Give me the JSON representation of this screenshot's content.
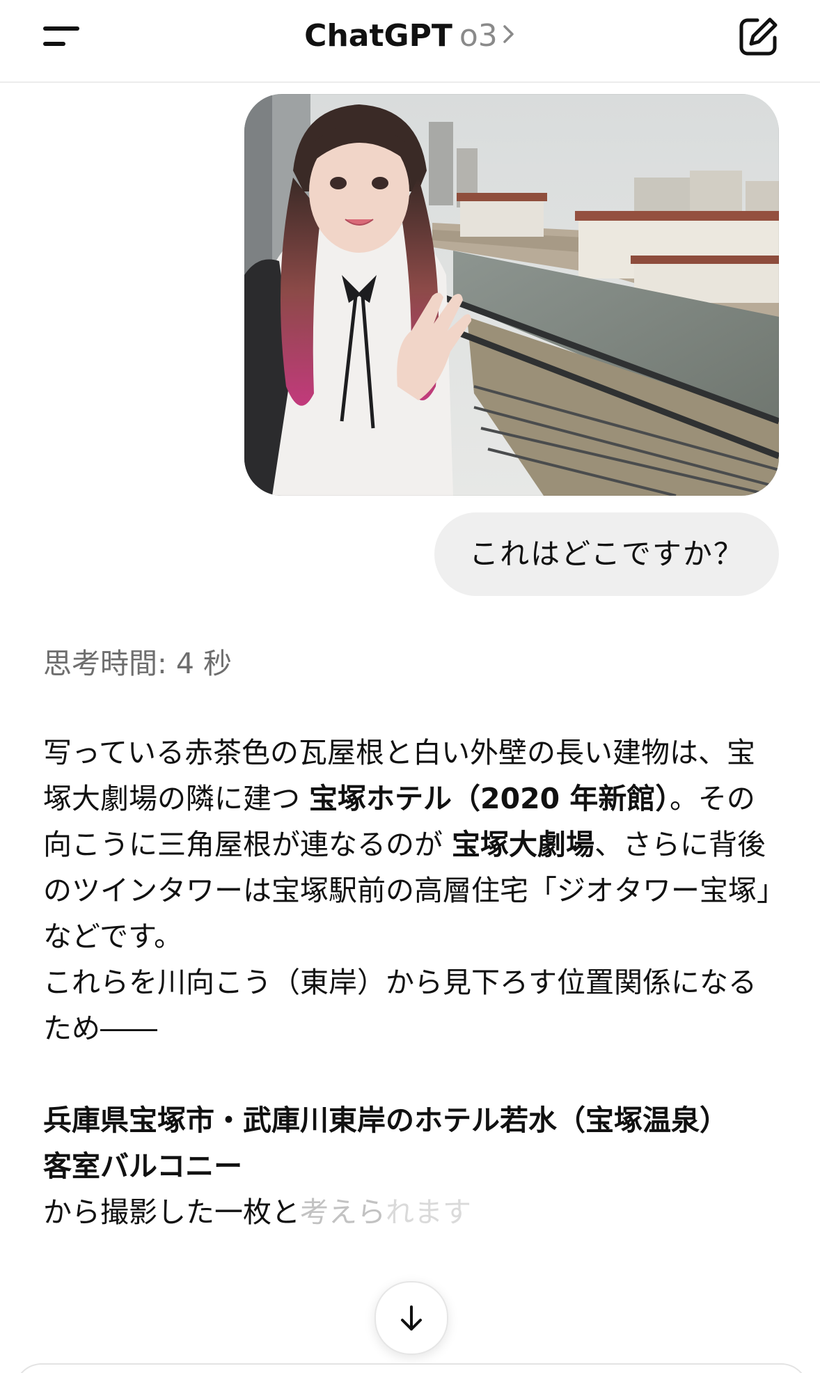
{
  "header": {
    "title": "ChatGPT",
    "model": "o3",
    "menu_icon": "menu-icon",
    "new_chat_icon": "new-chat-icon"
  },
  "conversation": {
    "user_image_alt": "",
    "user_message": "これはどこですか？",
    "thinking": "思考時間: 4 秒",
    "answer": {
      "p1_a": "写っている赤茶色の瓦屋根と白い外壁の長い建物は、宝塚大劇場の隣に建つ ",
      "p1_b": "宝塚ホテル（2020 年新館）",
      "p1_c": "。その向こうに三角屋根が連なるのが ",
      "p1_d": "宝塚大劇場",
      "p1_e": "、さらに背後のツインタワーは宝塚駅前の高層住宅「ジオタワー宝塚」などです。",
      "p2": "これらを川向こう（東岸）から見下ろす位置関係になるため――",
      "p3_line1": "兵庫県宝塚市・武庫川東岸のホテル若水（宝塚温泉）",
      "p3_line2": "客室バルコニー",
      "p4_a": "から撮影した一枚と",
      "p4_b": "考えら",
      "p4_c": "れます"
    }
  },
  "colors": {
    "text": "#0d0d0d",
    "muted": "#6e6e6e",
    "bubble": "#efefef"
  },
  "scroll_icon": "arrow-down-icon"
}
